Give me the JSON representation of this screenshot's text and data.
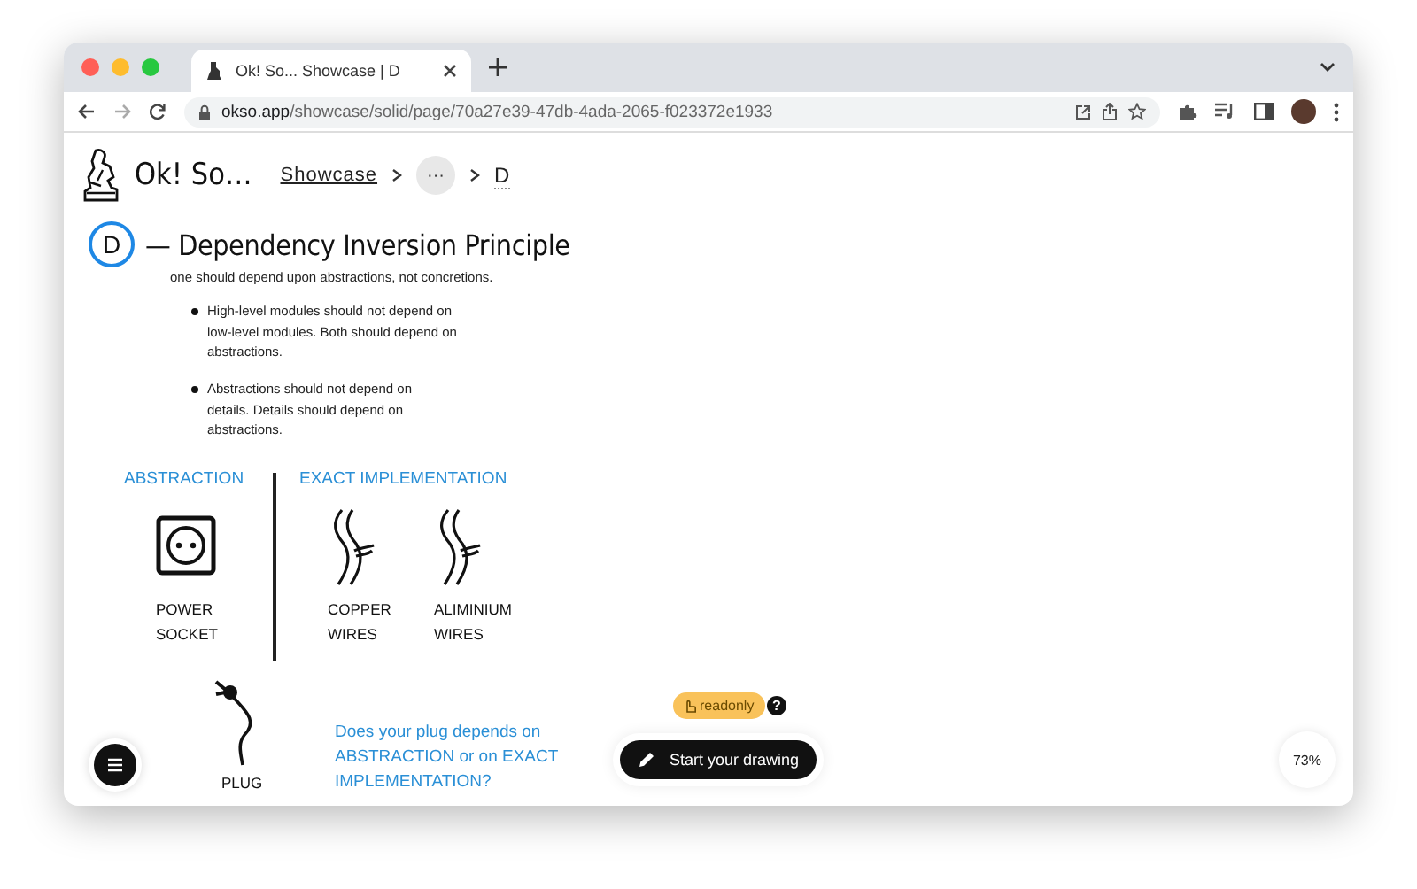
{
  "browser": {
    "tab_title": "Ok! So... Showcase | D",
    "url": "**okso.app**/showcase/solid/page/70a27e39-47db-4ada-2065-f023372e1933"
  },
  "header": {
    "logo_text": "Ok! So…",
    "breadcrumbs": [
      {
        "kind": "link",
        "label": "Showcase"
      },
      {
        "kind": "more",
        "label": "···"
      },
      {
        "kind": "current",
        "label": "D"
      }
    ]
  },
  "heading": {
    "letter": "D",
    "title": "— Dependency Inversion Principle",
    "subtitle": "one should depend upon abstractions, not concretions."
  },
  "bullets": [
    "High-level modules should not depend on low-level modules. Both should depend on abstractions.",
    "Abstractions should not depend on details. Details should depend on abstractions."
  ],
  "diagram": {
    "labels": [
      "ABSTRACTION",
      "EXACT IMPLEMENTATION"
    ],
    "items": [
      {
        "kind": "socket",
        "caption": "POWER SOCKET"
      },
      {
        "kind": "wire",
        "caption": "COPPER WIRES"
      },
      {
        "kind": "wire",
        "caption": "ALIMINIUM WIRES"
      },
      {
        "kind": "plug",
        "caption": "PLUG"
      }
    ],
    "question": "Does your plug depends on ABSTRACTION or on EXACT IMPLEMENTATION?"
  },
  "toolbar": {
    "badge": "readonly",
    "help": "?",
    "start_button": "Start your drawing",
    "zoom": "73%"
  }
}
